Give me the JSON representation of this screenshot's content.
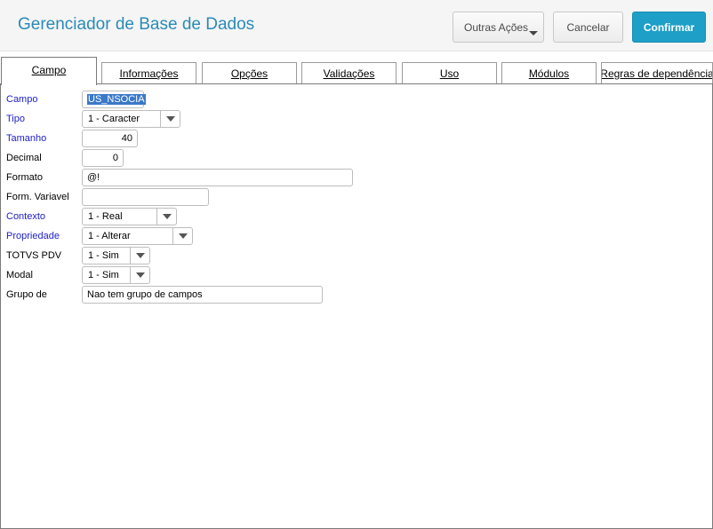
{
  "header": {
    "title": "Gerenciador de Base de Dados",
    "buttons": {
      "outras": "Outras Ações",
      "cancelar": "Cancelar",
      "confirmar": "Confirmar"
    }
  },
  "tabs": [
    {
      "label": "Campo"
    },
    {
      "label": "Informações"
    },
    {
      "label": "Opções"
    },
    {
      "label": "Validações"
    },
    {
      "label": "Uso"
    },
    {
      "label": "Módulos"
    },
    {
      "label": "Regras de dependência"
    }
  ],
  "form": {
    "campo": {
      "label": "Campo",
      "value": "US_NSOCIA"
    },
    "tipo": {
      "label": "Tipo",
      "value": "1 - Caracter"
    },
    "tamanho": {
      "label": "Tamanho",
      "value": "40"
    },
    "decimal": {
      "label": "Decimal",
      "value": "0"
    },
    "formato": {
      "label": "Formato",
      "value": "@!"
    },
    "form_variavel": {
      "label": "Form. Variavel",
      "value": ""
    },
    "contexto": {
      "label": "Contexto",
      "value": "1 - Real"
    },
    "propriedade": {
      "label": "Propriedade",
      "value": "1 - Alterar"
    },
    "totvs_pdv": {
      "label": "TOTVS PDV",
      "value": "1 - Sim"
    },
    "modal": {
      "label": "Modal",
      "value": "1 - Sim"
    },
    "grupo_de": {
      "label": "Grupo de",
      "value": "Nao tem grupo de campos"
    }
  },
  "colors": {
    "accent": "#1e9fc7",
    "title": "#2a8bb8",
    "required_label": "#1f22c4"
  }
}
